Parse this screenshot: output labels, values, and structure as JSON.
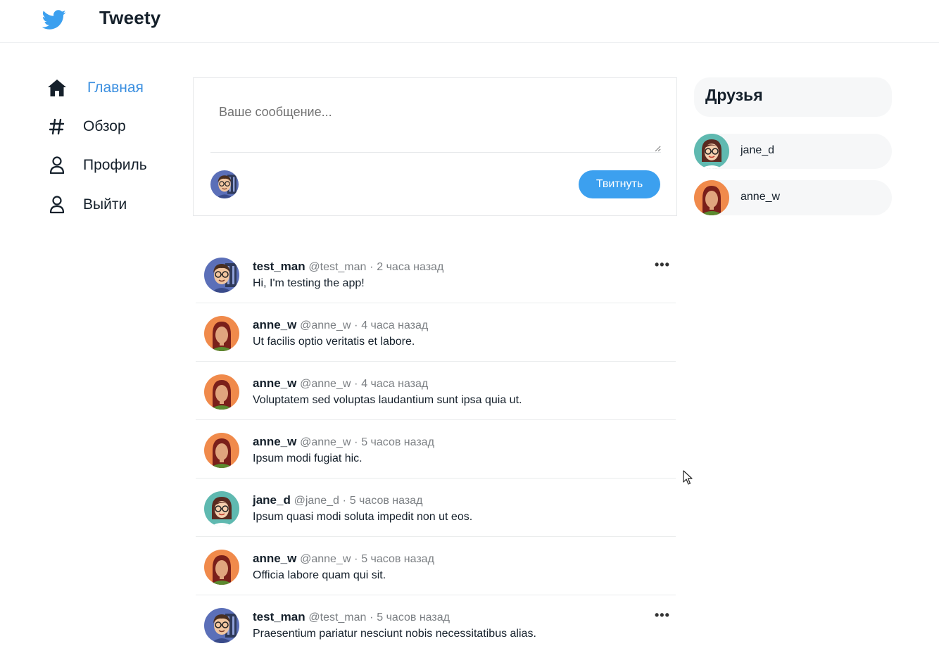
{
  "app": {
    "name": "Tweety",
    "logo_icon": "twitter-bird-icon",
    "accent": "#3ca0ef"
  },
  "nav": {
    "items": [
      {
        "label": "Главная",
        "icon": "home-icon",
        "active": true
      },
      {
        "label": "Обзор",
        "icon": "hashtag-icon",
        "active": false
      },
      {
        "label": "Профиль",
        "icon": "user-icon",
        "active": false
      },
      {
        "label": "Выйти",
        "icon": "user-icon",
        "active": false
      }
    ]
  },
  "composer": {
    "placeholder": "Ваше сообщение...",
    "value": "",
    "button_label": "Твитнуть"
  },
  "friends": {
    "title": "Друзья",
    "items": [
      {
        "name": "jane_d"
      },
      {
        "name": "anne_w"
      }
    ]
  },
  "feed": [
    {
      "username": "test_man",
      "handle": "@test_man",
      "time": "2 часа назад",
      "text": "Hi, I'm testing the app!",
      "has_menu": true
    },
    {
      "username": "anne_w",
      "handle": "@anne_w",
      "time": "4 часа назад",
      "text": "Ut facilis optio veritatis et labore.",
      "has_menu": false
    },
    {
      "username": "anne_w",
      "handle": "@anne_w",
      "time": "4 часа назад",
      "text": "Voluptatem sed voluptas laudantium sunt ipsa quia ut.",
      "has_menu": false
    },
    {
      "username": "anne_w",
      "handle": "@anne_w",
      "time": "5 часов назад",
      "text": "Ipsum modi fugiat hic.",
      "has_menu": false
    },
    {
      "username": "jane_d",
      "handle": "@jane_d",
      "time": "5 часов назад",
      "text": "Ipsum quasi modi soluta impedit non ut eos.",
      "has_menu": false
    },
    {
      "username": "anne_w",
      "handle": "@anne_w",
      "time": "5 часов назад",
      "text": "Officia labore quam qui sit.",
      "has_menu": false
    },
    {
      "username": "test_man",
      "handle": "@test_man",
      "time": "5 часов назад",
      "text": "Praesentium pariatur nesciunt nobis necessitatibus alias.",
      "has_menu": true
    }
  ],
  "meta_separator": "·",
  "menu_glyph": "•••"
}
